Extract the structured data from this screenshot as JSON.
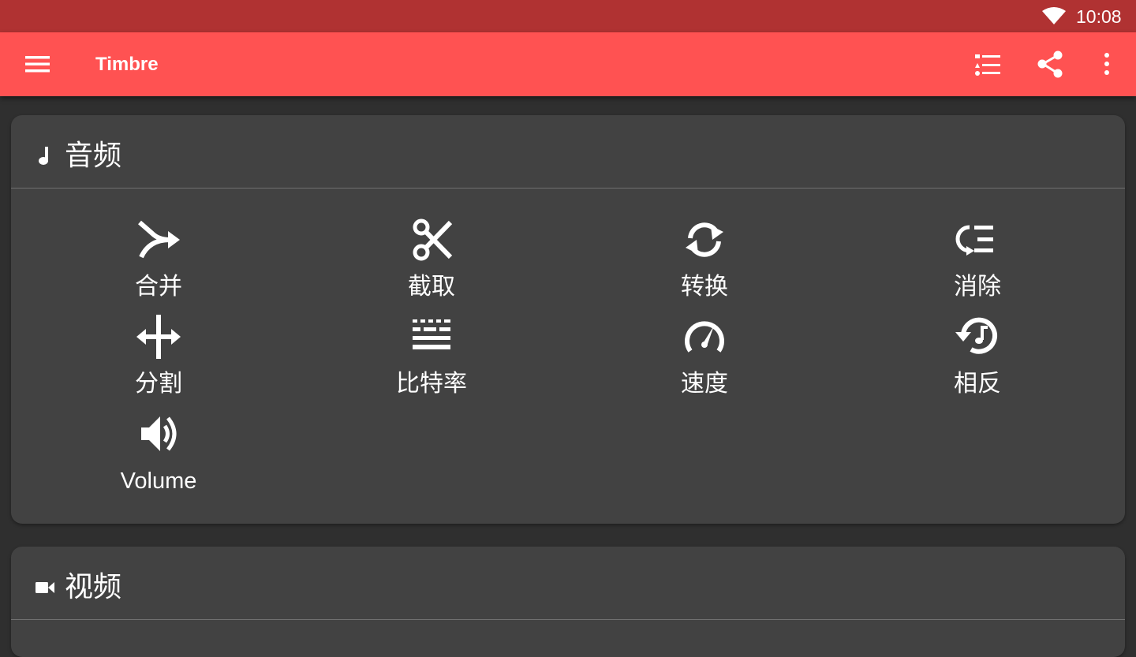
{
  "status_bar": {
    "time": "10:08",
    "icons": [
      "wifi-icon"
    ]
  },
  "app_bar": {
    "title": "Timbre",
    "background": "#ff5252",
    "icons": [
      "menu-icon",
      "list-icon",
      "share-icon",
      "more-vert-icon"
    ]
  },
  "audio_section": {
    "title": "音频",
    "icon": "music-note-icon",
    "tools": [
      {
        "label": "合并",
        "icon": "merge-icon"
      },
      {
        "label": "截取",
        "icon": "scissors-icon"
      },
      {
        "label": "转换",
        "icon": "convert-icon"
      },
      {
        "label": "消除",
        "icon": "remove-icon"
      },
      {
        "label": "分割",
        "icon": "split-icon"
      },
      {
        "label": "比特率",
        "icon": "bitrate-icon"
      },
      {
        "label": "速度",
        "icon": "speedometer-icon"
      },
      {
        "label": "相反",
        "icon": "reverse-icon"
      },
      {
        "label": "Volume",
        "icon": "volume-icon"
      }
    ]
  },
  "video_section": {
    "title": "视频",
    "icon": "videocam-icon"
  }
}
